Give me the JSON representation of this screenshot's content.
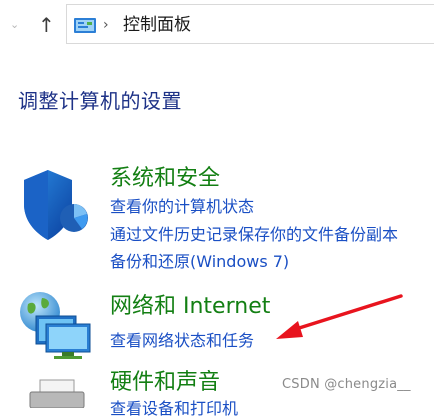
{
  "nav": {
    "breadcrumb": "控制面板",
    "separator": "›",
    "dropdown_glyph": "⌄",
    "up_glyph": "↑"
  },
  "page": {
    "title": "调整计算机的设置"
  },
  "categories": [
    {
      "title": "系统和安全",
      "icon": "shield-icon",
      "links": [
        "查看你的计算机状态",
        "通过文件历史记录保存你的文件备份副本",
        "备份和还原(Windows 7)"
      ]
    },
    {
      "title": "网络和 Internet",
      "icon": "network-icon",
      "links": [
        "查看网络状态和任务"
      ]
    },
    {
      "title": "硬件和声音",
      "icon": "printer-icon",
      "links": [
        "查看设备和打印机"
      ]
    }
  ],
  "watermark": "CSDN @chengzia__",
  "colors": {
    "title_blue": "#1e3287",
    "category_green": "#137f13",
    "link_blue": "#1a4fc4",
    "annotation_red": "#e8141e"
  }
}
